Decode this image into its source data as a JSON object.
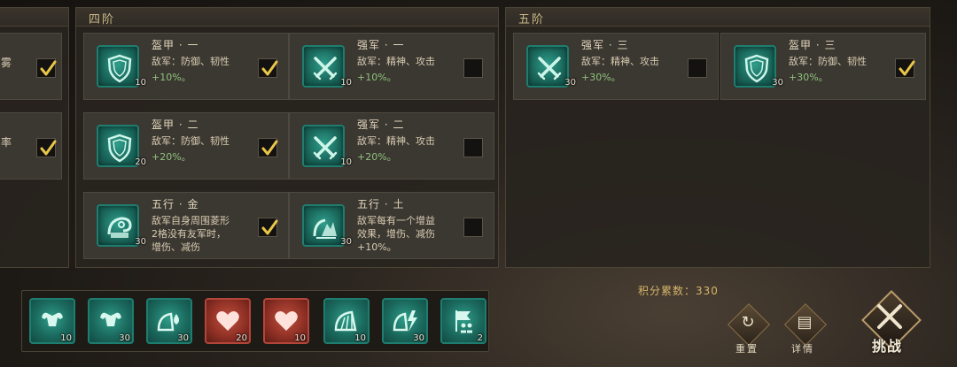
{
  "left_column": {
    "rows": [
      {
        "label": "雾",
        "checked": true
      },
      {
        "label": "率",
        "checked": true
      }
    ]
  },
  "tier4": {
    "title": "四阶",
    "cards": [
      {
        "title": "盔甲 · 一",
        "desc": "敌军：防御、韧性",
        "bonus": "+10%。",
        "level": "10",
        "icon": "shield-icon",
        "checked": true
      },
      {
        "title": "强军 · 一",
        "desc": "敌军：精神、攻击",
        "bonus": "+10%。",
        "level": "10",
        "icon": "crossed-swords-icon",
        "checked": false
      },
      {
        "title": "盔甲 · 二",
        "desc": "敌军：防御、韧性",
        "bonus": "+20%。",
        "level": "20",
        "icon": "shield-icon",
        "checked": true
      },
      {
        "title": "强军 · 二",
        "desc": "敌军：精神、攻击",
        "bonus": "+20%。",
        "level": "10",
        "icon": "crossed-swords-icon",
        "checked": false
      },
      {
        "title": "五行 · 金",
        "desc_lines": [
          "敌军自身周围菱形",
          "2格没有友军时，",
          "增伤、减伤"
        ],
        "level": "30",
        "icon": "metal-element-icon",
        "checked": true
      },
      {
        "title": "五行 · 土",
        "desc_lines": [
          "敌军每有一个增益",
          "效果，增伤、减伤",
          "+10%。"
        ],
        "level": "30",
        "icon": "earth-element-icon",
        "checked": false
      }
    ]
  },
  "tier5": {
    "title": "五阶",
    "cards": [
      {
        "title": "强军 · 三",
        "desc": "敌军：精神、攻击",
        "bonus": "+30%。",
        "level": "30",
        "icon": "crossed-swords-icon",
        "checked": false
      },
      {
        "title": "盔甲 · 三",
        "desc": "敌军：防御、韧性",
        "bonus": "+30%。",
        "level": "30",
        "icon": "shield-icon",
        "checked": true
      }
    ]
  },
  "tray": {
    "slots": [
      {
        "icon": "muscle-icon",
        "level": "10",
        "color": "teal"
      },
      {
        "icon": "muscle-icon",
        "level": "30",
        "color": "teal"
      },
      {
        "icon": "fan-drop-icon",
        "level": "30",
        "color": "teal"
      },
      {
        "icon": "heart-icon",
        "level": "20",
        "color": "red"
      },
      {
        "icon": "heart-icon",
        "level": "10",
        "color": "red"
      },
      {
        "icon": "fan-icon",
        "level": "10",
        "color": "teal"
      },
      {
        "icon": "fan-lightning-icon",
        "level": "30",
        "color": "teal"
      },
      {
        "icon": "banner-troops-icon",
        "level": "2",
        "color": "teal"
      }
    ]
  },
  "score": {
    "label": "积分累数：",
    "value": "330"
  },
  "buttons": {
    "reset": "重置",
    "details": "详情",
    "fight": "挑战"
  },
  "colors": {
    "accent_teal": "#1e7d6f",
    "bonus_green": "#8fc27d",
    "check_gold": "#e8c64a",
    "score_gold": "#d6b46a"
  }
}
